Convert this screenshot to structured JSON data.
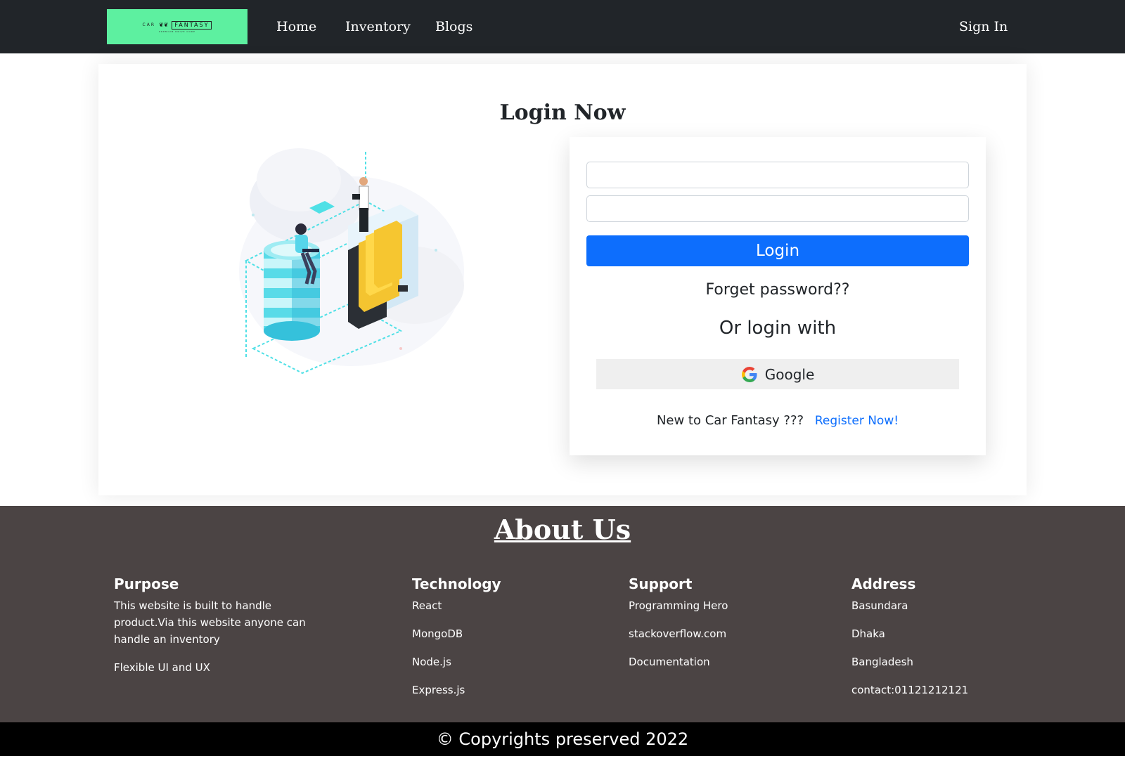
{
  "navbar": {
    "logo": {
      "brand_left": "CAR",
      "brand_right": "FANTASY",
      "tagline": "PREMIUM DRIVE CORP"
    },
    "links": [
      "Home",
      "Inventory",
      "Blogs"
    ],
    "sign_in": "Sign In"
  },
  "login": {
    "title": "Login Now",
    "email_value": "",
    "password_value": "",
    "login_button": "Login",
    "forget_password": "Forget password??",
    "or_login_with": "Or login with",
    "google_button": "Google",
    "new_user_text": "New to Car Fantasy ???",
    "register_link": "Register Now!"
  },
  "footer": {
    "title": "About Us",
    "columns": [
      {
        "heading": "Purpose",
        "items": [
          "This website is built to handle product.Via this website anyone can handle an inventory",
          "Flexible UI and UX"
        ]
      },
      {
        "heading": "Technology",
        "items": [
          "React",
          "MongoDB",
          "Node.js",
          "Express.js"
        ]
      },
      {
        "heading": "Support",
        "items": [
          "Programming Hero",
          "stackoverflow.com",
          "Documentation"
        ]
      },
      {
        "heading": "Address",
        "items": [
          "Basundara",
          "Dhaka",
          "Bangladesh",
          "contact:01121212121"
        ]
      }
    ],
    "copyright": "© Copyrights preserved 2022"
  },
  "colors": {
    "navbar_bg": "#212529",
    "logo_bg": "#5df0a0",
    "primary": "#0d6efd",
    "footer_bg": "#4b4444",
    "copyright_bg": "#000000"
  },
  "icons": {
    "google": "google-icon",
    "illustration": "data-storage-illustration"
  }
}
